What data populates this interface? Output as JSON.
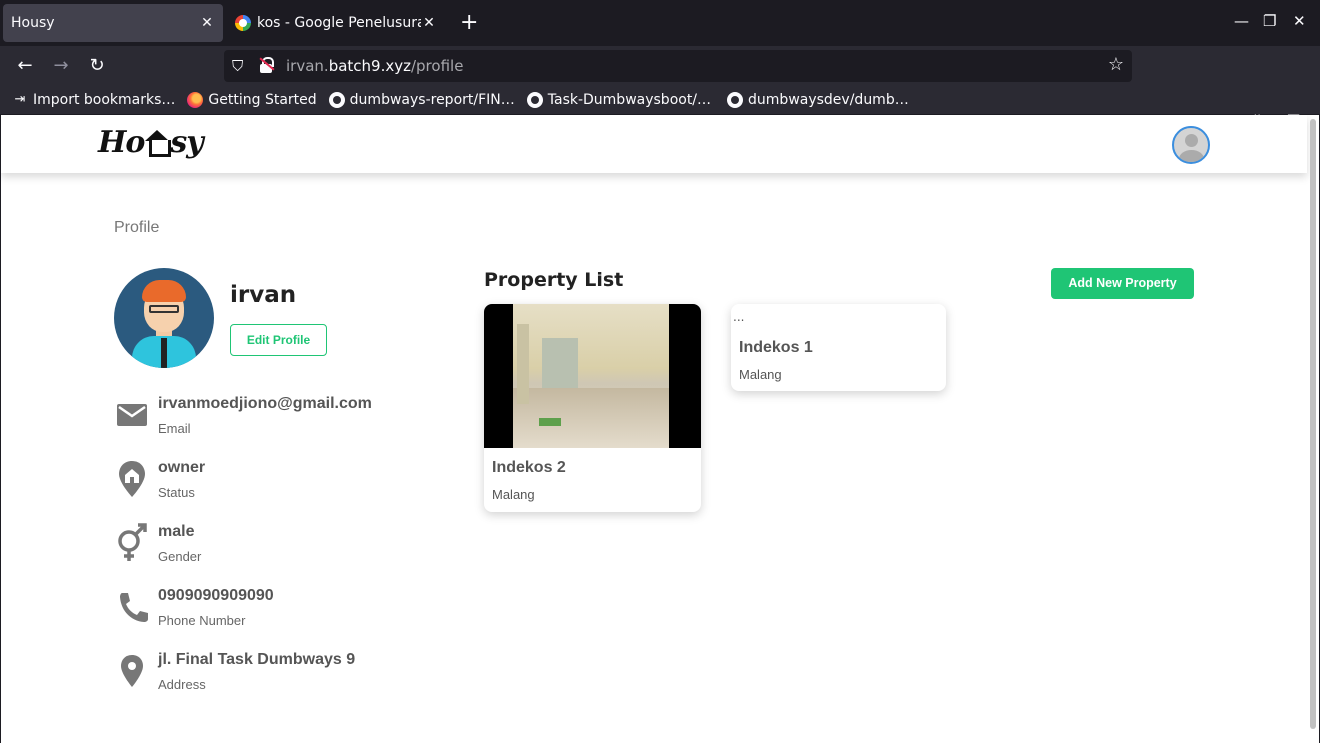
{
  "browser": {
    "tabs": [
      {
        "title": "Housy",
        "active": true
      },
      {
        "title": "kos - Google Penelusuran",
        "active": false
      }
    ],
    "new_tab": "+",
    "url_prefix": "irvan.",
    "url_domain": "batch9.xyz",
    "url_path": "/profile",
    "bookmarks": [
      "Import bookmarks…",
      "Getting Started",
      "dumbways-report/FIN…",
      "Task-Dumbwaysboot/…",
      "dumbwaysdev/dumb…"
    ]
  },
  "page": {
    "logo_text_left": "Ho",
    "logo_text_right": "sy",
    "breadcrumb": "Profile",
    "user": {
      "name": "irvan",
      "edit_label": "Edit Profile"
    },
    "info": [
      {
        "value": "irvanmoedjiono@gmail.com",
        "label": "Email",
        "icon": "mail-icon"
      },
      {
        "value": "owner",
        "label": "Status",
        "icon": "home-pin-icon"
      },
      {
        "value": "male",
        "label": "Gender",
        "icon": "gender-icon"
      },
      {
        "value": "0909090909090",
        "label": "Phone Number",
        "icon": "phone-icon"
      },
      {
        "value": "jl. Final Task Dumbways 9",
        "label": "Address",
        "icon": "location-icon"
      }
    ],
    "property_list_title": "Property List",
    "add_property_label": "Add New Property",
    "properties": [
      {
        "name": "Indekos 2",
        "city": "Malang",
        "has_photo": true
      },
      {
        "name": "Indekos 1",
        "city": "Malang",
        "has_photo": false,
        "broken_image_text": "..."
      }
    ],
    "colors": {
      "accent": "#1fc575",
      "avatar_border": "#3b8ede"
    }
  }
}
